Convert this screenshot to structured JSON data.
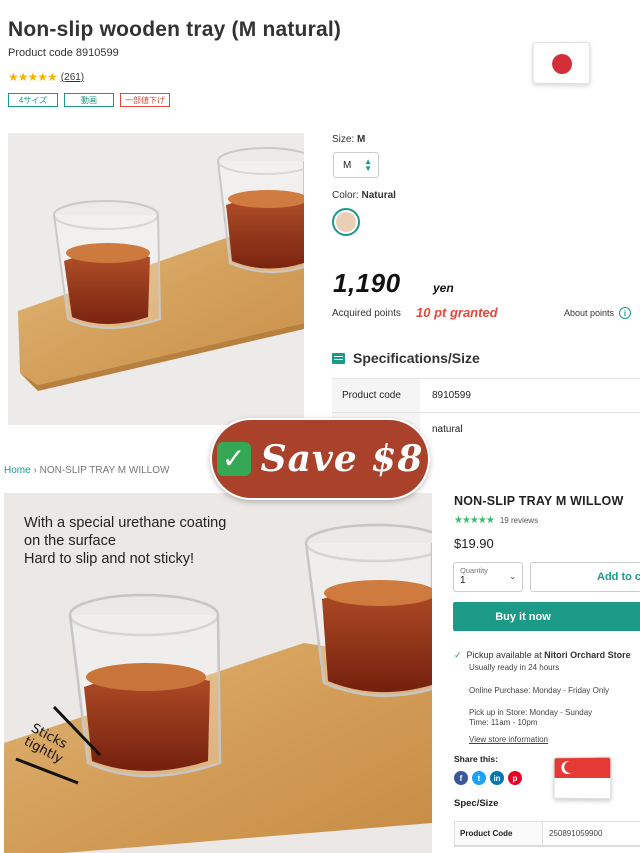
{
  "jp": {
    "title": "Non-slip wooden tray (M natural)",
    "product_code": "Product code 8910599",
    "stars": "★★★★★",
    "review_count": "(261)",
    "tags": [
      "4サイズ",
      "動画",
      "一部値下げ"
    ],
    "size_label": "Size:",
    "size_value": "M",
    "size_select": "M",
    "color_label": "Color:",
    "color_value": "Natural",
    "swatch_color": "#e8cfb6",
    "price": "1,190",
    "currency": "yen",
    "acquired_label": "Acquired points",
    "points": "10 pt granted",
    "about_points": "About points",
    "spec_heading": "Specifications/Size",
    "spec_rows": [
      {
        "key": "Product code",
        "value": "8910599"
      },
      {
        "key": "",
        "value": "natural"
      }
    ]
  },
  "badge": {
    "text": "Save $8"
  },
  "sg": {
    "breadcrumb_home": "Home",
    "breadcrumb_sep": "›",
    "breadcrumb_current": "NON-SLIP TRAY M WILLOW",
    "overlay_line1": "With a special urethane coating",
    "overlay_line2": "on the surface",
    "overlay_line3": "Hard to slip and not sticky!",
    "sticks_line1": "Sticks",
    "sticks_line2": "tightly",
    "title": "NON-SLIP TRAY M WILLOW",
    "stars": "★★★★★",
    "reviews": "19 reviews",
    "price": "$19.90",
    "qty_label": "Quantity",
    "qty_value": "1",
    "add_to_cart": "Add to cart",
    "buy_now": "Buy it now",
    "pickup_prefix": "Pickup available at ",
    "pickup_store": "Nitori Orchard Store",
    "ready": "Usually ready in 24 hours",
    "online": "Online Purchase: Monday - Friday Only",
    "pickup_days": "Pick up in Store: Monday - Sunday",
    "pickup_time": "Time: 11am - 10pm",
    "store_info": "View store information",
    "share": "Share this:",
    "spec_heading": "Spec/Size",
    "spec_rows": [
      {
        "key": "Product Code",
        "value": "250891059900"
      }
    ]
  },
  "colors": {
    "teal": "#1a9a87",
    "red": "#e0493d",
    "badge": "#a9412b",
    "sg_stars": "#37c26a"
  },
  "icons": [
    "star-icon",
    "info-icon",
    "spec-icon",
    "check-icon",
    "chevron-down-icon",
    "facebook-icon",
    "twitter-icon",
    "linkedin-icon",
    "pinterest-icon",
    "japan-flag",
    "singapore-flag"
  ]
}
